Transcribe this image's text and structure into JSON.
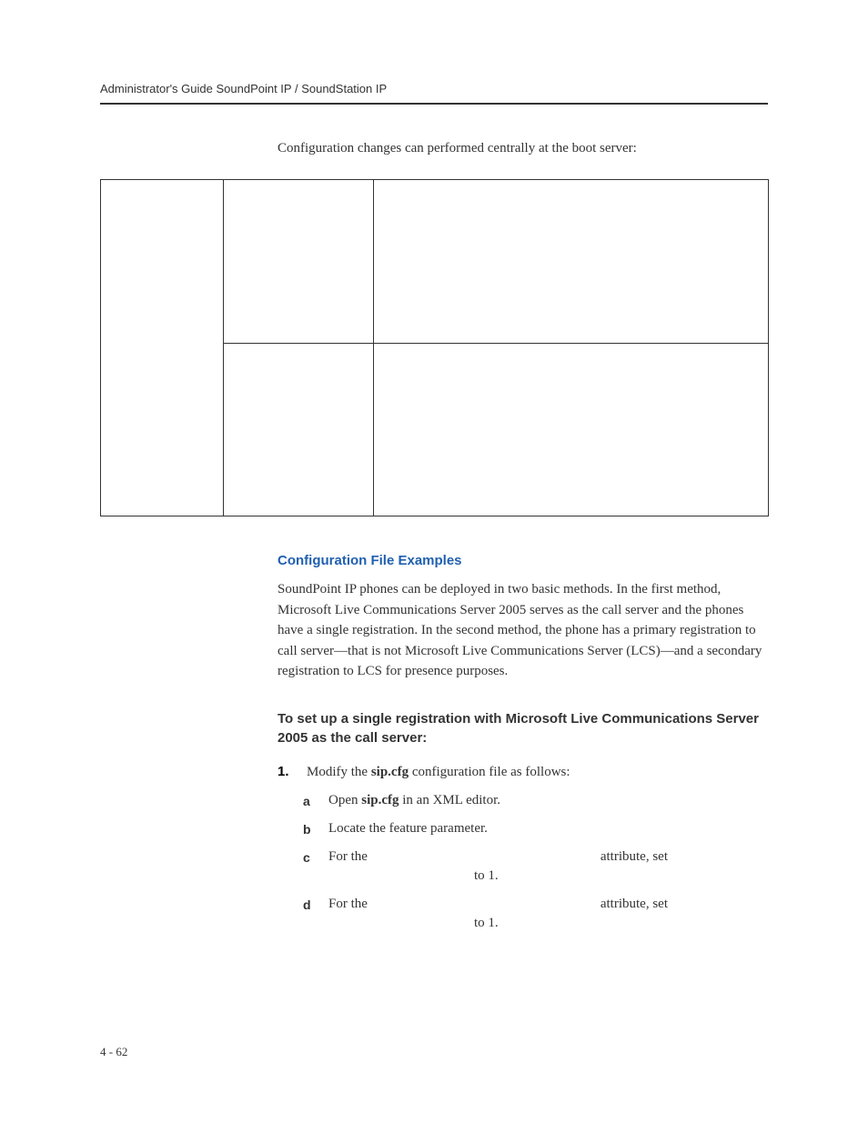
{
  "header": {
    "title": "Administrator's Guide SoundPoint IP / SoundStation IP"
  },
  "intro": "Configuration changes can performed centrally at the boot server:",
  "section_heading": "Configuration File Examples",
  "body_paragraph": "SoundPoint IP phones can be deployed in two basic methods. In the first method, Microsoft Live Communications Server 2005 serves as the call server and the phones have a single registration. In the second method, the phone has a primary registration to call server—that is not Microsoft Live Communications Server (LCS)—and a secondary registration to LCS for presence purposes.",
  "procedure_heading": "To set up a single registration with Microsoft Live Communications Server 2005 as the call server:",
  "step1": {
    "number": "1.",
    "text_before": "Modify the ",
    "bold": "sip.cfg",
    "text_after": " configuration file as follows:",
    "substeps": {
      "a": {
        "letter": "a",
        "text_before": "Open ",
        "bold": "sip.cfg",
        "text_after": " in an XML editor."
      },
      "b": {
        "letter": "b",
        "text": "Locate the feature parameter."
      },
      "c": {
        "letter": "c",
        "text_before": "For the ",
        "text_attr": " attribute, set",
        "continuation": " to 1."
      },
      "d": {
        "letter": "d",
        "text_before": "For the ",
        "text_attr": " attribute, set",
        "continuation": " to 1."
      }
    }
  },
  "footer": "4 - 62"
}
